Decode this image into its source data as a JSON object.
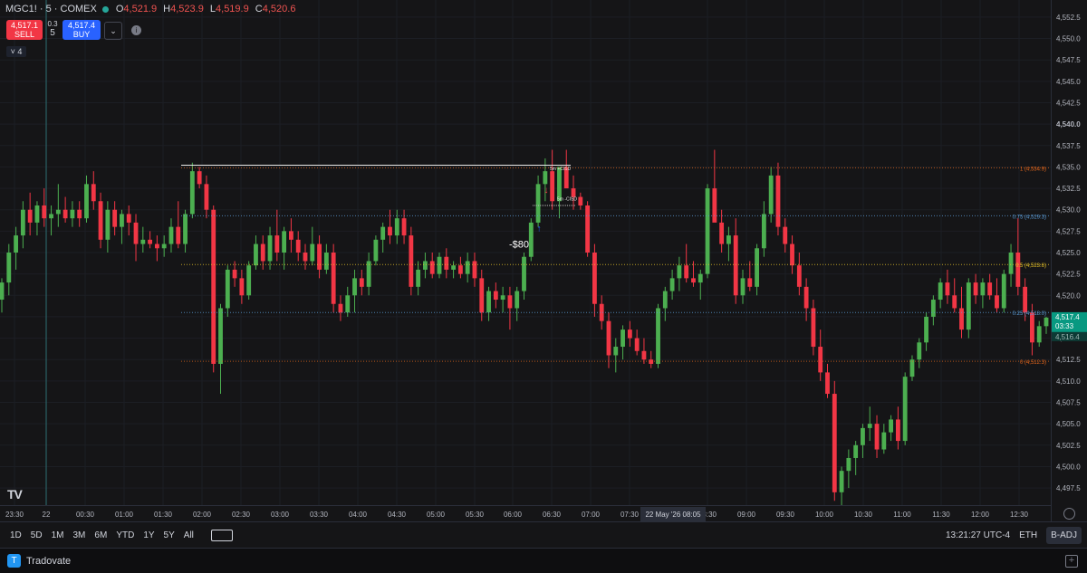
{
  "header": {
    "symbol": "MGC1! · 5 · COMEX",
    "ohlc": [
      {
        "k": "O",
        "v": "4,521.9"
      },
      {
        "k": "H",
        "v": "4,523.9"
      },
      {
        "k": "L",
        "v": "4,519.9"
      },
      {
        "k": "C",
        "v": "4,520.6"
      }
    ]
  },
  "trade": {
    "sell_price": "4,517.1",
    "sell_label": "SELL",
    "spread_top": "0.3",
    "spread_qty": "5",
    "buy_price": "4,517.4",
    "buy_label": "BUY",
    "collapse_count": "4"
  },
  "colors": {
    "up": "#4caf50",
    "down": "#f23645",
    "bg": "#151517",
    "grid": "#1e2026",
    "orange": "#e0651c",
    "blue": "#5b9bd5",
    "yellow": "#e6c229"
  },
  "price_axis": {
    "ticks": [
      "4,552.5",
      "4,550.0",
      "4,547.5",
      "4,545.0",
      "4,542.5",
      "4,540.0",
      "4,537.5",
      "4,535.0",
      "4,532.5",
      "4,530.0",
      "4,527.5",
      "4,525.0",
      "4,522.5",
      "4,520.0",
      "4,517.5",
      "4,515.0",
      "4,512.5",
      "4,510.0",
      "4,507.5",
      "4,505.0",
      "4,502.5",
      "4,500.0",
      "4,497.5"
    ],
    "current_price": "4,517.4",
    "countdown": "03:33",
    "prev_label": "4,516.4"
  },
  "time_axis": {
    "ticks": [
      "23:30",
      "22",
      "00:30",
      "01:00",
      "01:30",
      "02:00",
      "02:30",
      "03:00",
      "03:30",
      "04:00",
      "04:30",
      "05:00",
      "05:30",
      "06:00",
      "06:30",
      "07:00",
      "07:30",
      "08:30",
      "09:00",
      "09:30",
      "10:00",
      "10:30",
      "11:00",
      "11:30",
      "12:00",
      "12:30"
    ],
    "crosshair_label": "22 May '26   08:05"
  },
  "annotations": {
    "pnl": "-$80",
    "cisd_up": "5m +CISD",
    "cisd_down": "5m -CISD"
  },
  "fib_levels": [
    {
      "label": "1 (4,534.9)",
      "price": 4534.9,
      "color": "#e0651c"
    },
    {
      "label": "0.75 (4,529.3)",
      "price": 4529.3,
      "color": "#5b9bd5"
    },
    {
      "label": "0.5 (4,523.6)",
      "price": 4523.6,
      "color": "#e6c229"
    },
    {
      "label": "0.25 (4,518.0)",
      "price": 4518.0,
      "color": "#5b9bd5"
    },
    {
      "label": "0 (4,512.3)",
      "price": 4512.3,
      "color": "#e0651c"
    }
  ],
  "chart_data": {
    "type": "candlestick",
    "symbol": "MGC1!",
    "interval": "5",
    "ylim": [
      4495.5,
      4554.5
    ],
    "x_range": [
      "23:30",
      "12:50"
    ],
    "candles": [
      {
        "o": 4519.5,
        "h": 4522,
        "l": 4518,
        "c": 4521.5
      },
      {
        "o": 4521.5,
        "h": 4526,
        "l": 4520,
        "c": 4525
      },
      {
        "o": 4525,
        "h": 4528,
        "l": 4523,
        "c": 4527
      },
      {
        "o": 4527,
        "h": 4531,
        "l": 4525.5,
        "c": 4530
      },
      {
        "o": 4530,
        "h": 4532,
        "l": 4527,
        "c": 4528.5
      },
      {
        "o": 4528.5,
        "h": 4531,
        "l": 4527,
        "c": 4530.5
      },
      {
        "o": 4530.5,
        "h": 4532.5,
        "l": 4528,
        "c": 4529
      },
      {
        "o": 4529,
        "h": 4530.5,
        "l": 4527,
        "c": 4529.5
      },
      {
        "o": 4529.5,
        "h": 4533,
        "l": 4528,
        "c": 4530
      },
      {
        "o": 4530,
        "h": 4531.5,
        "l": 4528.5,
        "c": 4529
      },
      {
        "o": 4529,
        "h": 4531,
        "l": 4528,
        "c": 4530
      },
      {
        "o": 4530,
        "h": 4531,
        "l": 4528,
        "c": 4529
      },
      {
        "o": 4529,
        "h": 4534,
        "l": 4528.5,
        "c": 4533
      },
      {
        "o": 4533,
        "h": 4534.5,
        "l": 4530,
        "c": 4531
      },
      {
        "o": 4531,
        "h": 4532,
        "l": 4525.5,
        "c": 4526.5
      },
      {
        "o": 4526.5,
        "h": 4531,
        "l": 4525,
        "c": 4530
      },
      {
        "o": 4530,
        "h": 4531,
        "l": 4527,
        "c": 4528
      },
      {
        "o": 4528,
        "h": 4530,
        "l": 4526,
        "c": 4529.5
      },
      {
        "o": 4529.5,
        "h": 4530.5,
        "l": 4527,
        "c": 4528.5
      },
      {
        "o": 4528.5,
        "h": 4529.5,
        "l": 4524,
        "c": 4526
      },
      {
        "o": 4526,
        "h": 4528,
        "l": 4525,
        "c": 4526.5
      },
      {
        "o": 4526.5,
        "h": 4527.5,
        "l": 4525.5,
        "c": 4526
      },
      {
        "o": 4526,
        "h": 4527,
        "l": 4524,
        "c": 4525.5
      },
      {
        "o": 4525.5,
        "h": 4527,
        "l": 4524.5,
        "c": 4526
      },
      {
        "o": 4526,
        "h": 4529,
        "l": 4525,
        "c": 4528
      },
      {
        "o": 4528,
        "h": 4531,
        "l": 4525.5,
        "c": 4526
      },
      {
        "o": 4526,
        "h": 4530,
        "l": 4525,
        "c": 4529.5
      },
      {
        "o": 4529.5,
        "h": 4535.5,
        "l": 4529,
        "c": 4534.5
      },
      {
        "o": 4534.5,
        "h": 4535,
        "l": 4532.5,
        "c": 4533
      },
      {
        "o": 4533,
        "h": 4534,
        "l": 4529,
        "c": 4530
      },
      {
        "o": 4530,
        "h": 4530.5,
        "l": 4511,
        "c": 4512
      },
      {
        "o": 4512,
        "h": 4519,
        "l": 4508.5,
        "c": 4518.5
      },
      {
        "o": 4518.5,
        "h": 4523.5,
        "l": 4517.5,
        "c": 4523
      },
      {
        "o": 4523,
        "h": 4524,
        "l": 4521,
        "c": 4522
      },
      {
        "o": 4522,
        "h": 4523,
        "l": 4519,
        "c": 4520
      },
      {
        "o": 4520,
        "h": 4524,
        "l": 4519.5,
        "c": 4523.5
      },
      {
        "o": 4523.5,
        "h": 4527,
        "l": 4523,
        "c": 4526
      },
      {
        "o": 4526,
        "h": 4527,
        "l": 4523,
        "c": 4524
      },
      {
        "o": 4524,
        "h": 4528,
        "l": 4523,
        "c": 4527
      },
      {
        "o": 4527,
        "h": 4530,
        "l": 4524,
        "c": 4525
      },
      {
        "o": 4525,
        "h": 4528,
        "l": 4523,
        "c": 4527.5
      },
      {
        "o": 4527.5,
        "h": 4529,
        "l": 4525,
        "c": 4526.5
      },
      {
        "o": 4526.5,
        "h": 4527.5,
        "l": 4524,
        "c": 4525
      },
      {
        "o": 4525,
        "h": 4526,
        "l": 4523,
        "c": 4524
      },
      {
        "o": 4524,
        "h": 4528,
        "l": 4523.5,
        "c": 4526
      },
      {
        "o": 4526,
        "h": 4527,
        "l": 4522,
        "c": 4523
      },
      {
        "o": 4523,
        "h": 4526,
        "l": 4522.5,
        "c": 4525
      },
      {
        "o": 4525,
        "h": 4526,
        "l": 4518,
        "c": 4519
      },
      {
        "o": 4519,
        "h": 4520,
        "l": 4517,
        "c": 4518
      },
      {
        "o": 4518,
        "h": 4521,
        "l": 4517.5,
        "c": 4520
      },
      {
        "o": 4520,
        "h": 4523,
        "l": 4518,
        "c": 4522
      },
      {
        "o": 4522,
        "h": 4523,
        "l": 4520,
        "c": 4521
      },
      {
        "o": 4521,
        "h": 4525,
        "l": 4520,
        "c": 4524
      },
      {
        "o": 4524,
        "h": 4527,
        "l": 4523.5,
        "c": 4526.5
      },
      {
        "o": 4526.5,
        "h": 4528.5,
        "l": 4525,
        "c": 4528
      },
      {
        "o": 4528,
        "h": 4530,
        "l": 4526,
        "c": 4527
      },
      {
        "o": 4527,
        "h": 4530,
        "l": 4526,
        "c": 4529
      },
      {
        "o": 4529,
        "h": 4530,
        "l": 4526,
        "c": 4527
      },
      {
        "o": 4527,
        "h": 4528,
        "l": 4520,
        "c": 4521
      },
      {
        "o": 4521,
        "h": 4524,
        "l": 4520,
        "c": 4523
      },
      {
        "o": 4523,
        "h": 4525,
        "l": 4522,
        "c": 4524
      },
      {
        "o": 4524,
        "h": 4525,
        "l": 4522,
        "c": 4522.5
      },
      {
        "o": 4522.5,
        "h": 4525,
        "l": 4522,
        "c": 4524.5
      },
      {
        "o": 4524.5,
        "h": 4525.5,
        "l": 4522,
        "c": 4523
      },
      {
        "o": 4523,
        "h": 4524,
        "l": 4522,
        "c": 4523.5
      },
      {
        "o": 4523.5,
        "h": 4524.5,
        "l": 4522,
        "c": 4522.5
      },
      {
        "o": 4522.5,
        "h": 4525,
        "l": 4521.5,
        "c": 4524
      },
      {
        "o": 4524,
        "h": 4525,
        "l": 4521,
        "c": 4522
      },
      {
        "o": 4522,
        "h": 4523,
        "l": 4517,
        "c": 4518
      },
      {
        "o": 4518,
        "h": 4521,
        "l": 4517,
        "c": 4520.5
      },
      {
        "o": 4520.5,
        "h": 4521.5,
        "l": 4518.5,
        "c": 4519.5
      },
      {
        "o": 4519.5,
        "h": 4521,
        "l": 4518,
        "c": 4520
      },
      {
        "o": 4520,
        "h": 4521,
        "l": 4516,
        "c": 4518.5
      },
      {
        "o": 4518.5,
        "h": 4521,
        "l": 4517,
        "c": 4520.5
      },
      {
        "o": 4520.5,
        "h": 4525,
        "l": 4519.5,
        "c": 4524.5
      },
      {
        "o": 4524.5,
        "h": 4529,
        "l": 4524,
        "c": 4528.5
      },
      {
        "o": 4528.5,
        "h": 4534,
        "l": 4528,
        "c": 4533
      },
      {
        "o": 4533,
        "h": 4536,
        "l": 4531,
        "c": 4534.5
      },
      {
        "o": 4534.5,
        "h": 4537,
        "l": 4530,
        "c": 4531
      },
      {
        "o": 4531,
        "h": 4535,
        "l": 4529,
        "c": 4535
      },
      {
        "o": 4535,
        "h": 4537,
        "l": 4533,
        "c": 4532.5
      },
      {
        "o": 4532.5,
        "h": 4534,
        "l": 4530,
        "c": 4531.5
      },
      {
        "o": 4531.5,
        "h": 4532,
        "l": 4530,
        "c": 4530.5
      },
      {
        "o": 4530.5,
        "h": 4531,
        "l": 4524.5,
        "c": 4525
      },
      {
        "o": 4525,
        "h": 4526,
        "l": 4517.5,
        "c": 4519
      },
      {
        "o": 4519,
        "h": 4520,
        "l": 4516,
        "c": 4517
      },
      {
        "o": 4517,
        "h": 4518,
        "l": 4511.5,
        "c": 4513
      },
      {
        "o": 4513,
        "h": 4515,
        "l": 4511,
        "c": 4514
      },
      {
        "o": 4514,
        "h": 4516.5,
        "l": 4512.5,
        "c": 4516
      },
      {
        "o": 4516,
        "h": 4517,
        "l": 4514,
        "c": 4515
      },
      {
        "o": 4515,
        "h": 4516,
        "l": 4513,
        "c": 4513.5
      },
      {
        "o": 4513.5,
        "h": 4515,
        "l": 4512,
        "c": 4512.5
      },
      {
        "o": 4512.5,
        "h": 4513.5,
        "l": 4511.5,
        "c": 4512
      },
      {
        "o": 4512,
        "h": 4519,
        "l": 4511.5,
        "c": 4518.5
      },
      {
        "o": 4518.5,
        "h": 4521,
        "l": 4517,
        "c": 4520.5
      },
      {
        "o": 4520.5,
        "h": 4523,
        "l": 4519.5,
        "c": 4522
      },
      {
        "o": 4522,
        "h": 4524.5,
        "l": 4520.5,
        "c": 4523.5
      },
      {
        "o": 4523.5,
        "h": 4526,
        "l": 4521.5,
        "c": 4522
      },
      {
        "o": 4522,
        "h": 4524,
        "l": 4521,
        "c": 4521.5
      },
      {
        "o": 4521.5,
        "h": 4523,
        "l": 4519.5,
        "c": 4522.5
      },
      {
        "o": 4522.5,
        "h": 4533,
        "l": 4522,
        "c": 4532.5
      },
      {
        "o": 4532.5,
        "h": 4537,
        "l": 4530,
        "c": 4528.5
      },
      {
        "o": 4528.5,
        "h": 4530,
        "l": 4525,
        "c": 4526
      },
      {
        "o": 4526,
        "h": 4528,
        "l": 4524,
        "c": 4527
      },
      {
        "o": 4527,
        "h": 4529,
        "l": 4519,
        "c": 4520
      },
      {
        "o": 4520,
        "h": 4523,
        "l": 4519,
        "c": 4522
      },
      {
        "o": 4522,
        "h": 4524,
        "l": 4520.5,
        "c": 4521
      },
      {
        "o": 4521,
        "h": 4526,
        "l": 4520,
        "c": 4525.5
      },
      {
        "o": 4525.5,
        "h": 4531,
        "l": 4524.5,
        "c": 4529.5
      },
      {
        "o": 4529.5,
        "h": 4535,
        "l": 4528.5,
        "c": 4534
      },
      {
        "o": 4534,
        "h": 4535.5,
        "l": 4527,
        "c": 4528
      },
      {
        "o": 4528,
        "h": 4529,
        "l": 4525,
        "c": 4526
      },
      {
        "o": 4526,
        "h": 4527,
        "l": 4522.5,
        "c": 4523.5
      },
      {
        "o": 4523.5,
        "h": 4525,
        "l": 4520,
        "c": 4521
      },
      {
        "o": 4521,
        "h": 4522,
        "l": 4517,
        "c": 4518.5
      },
      {
        "o": 4518.5,
        "h": 4519.5,
        "l": 4513,
        "c": 4514
      },
      {
        "o": 4514,
        "h": 4516,
        "l": 4510,
        "c": 4511
      },
      {
        "o": 4511,
        "h": 4512,
        "l": 4508,
        "c": 4508.5
      },
      {
        "o": 4508.5,
        "h": 4510,
        "l": 4496,
        "c": 4497
      },
      {
        "o": 4497,
        "h": 4500,
        "l": 4495.5,
        "c": 4499.5
      },
      {
        "o": 4499.5,
        "h": 4502,
        "l": 4497.5,
        "c": 4501
      },
      {
        "o": 4501,
        "h": 4503,
        "l": 4499,
        "c": 4502.5
      },
      {
        "o": 4502.5,
        "h": 4505,
        "l": 4501,
        "c": 4504.5
      },
      {
        "o": 4504.5,
        "h": 4507,
        "l": 4503,
        "c": 4505
      },
      {
        "o": 4505,
        "h": 4506,
        "l": 4501,
        "c": 4502
      },
      {
        "o": 4502,
        "h": 4505,
        "l": 4501.5,
        "c": 4504
      },
      {
        "o": 4504,
        "h": 4506,
        "l": 4503,
        "c": 4505.5
      },
      {
        "o": 4505.5,
        "h": 4507,
        "l": 4502,
        "c": 4503
      },
      {
        "o": 4503,
        "h": 4511,
        "l": 4502.5,
        "c": 4510.5
      },
      {
        "o": 4510.5,
        "h": 4513,
        "l": 4510,
        "c": 4512.5
      },
      {
        "o": 4512.5,
        "h": 4515,
        "l": 4511.5,
        "c": 4514.5
      },
      {
        "o": 4514.5,
        "h": 4518,
        "l": 4513.5,
        "c": 4517.5
      },
      {
        "o": 4517.5,
        "h": 4520,
        "l": 4516.5,
        "c": 4519.5
      },
      {
        "o": 4519.5,
        "h": 4522,
        "l": 4518.5,
        "c": 4521.5
      },
      {
        "o": 4521.5,
        "h": 4523,
        "l": 4519,
        "c": 4520
      },
      {
        "o": 4520,
        "h": 4522,
        "l": 4518,
        "c": 4518.5
      },
      {
        "o": 4518.5,
        "h": 4521,
        "l": 4515,
        "c": 4516
      },
      {
        "o": 4516,
        "h": 4522,
        "l": 4515,
        "c": 4521.5
      },
      {
        "o": 4521.5,
        "h": 4522.5,
        "l": 4519,
        "c": 4520
      },
      {
        "o": 4520,
        "h": 4522,
        "l": 4518.5,
        "c": 4521.5
      },
      {
        "o": 4521.5,
        "h": 4522.5,
        "l": 4519.5,
        "c": 4520
      },
      {
        "o": 4520,
        "h": 4522,
        "l": 4518,
        "c": 4518.5
      },
      {
        "o": 4518.5,
        "h": 4523,
        "l": 4518,
        "c": 4522.5
      },
      {
        "o": 4522.5,
        "h": 4526,
        "l": 4521,
        "c": 4525
      },
      {
        "o": 4525,
        "h": 4529,
        "l": 4520,
        "c": 4521
      },
      {
        "o": 4521,
        "h": 4522,
        "l": 4517,
        "c": 4518
      },
      {
        "o": 4518,
        "h": 4519,
        "l": 4513,
        "c": 4514.5
      },
      {
        "o": 4514.5,
        "h": 4517,
        "l": 4514,
        "c": 4516.4
      },
      {
        "o": 4516.4,
        "h": 4517.5,
        "l": 4515.5,
        "c": 4517.4
      }
    ]
  }
}
